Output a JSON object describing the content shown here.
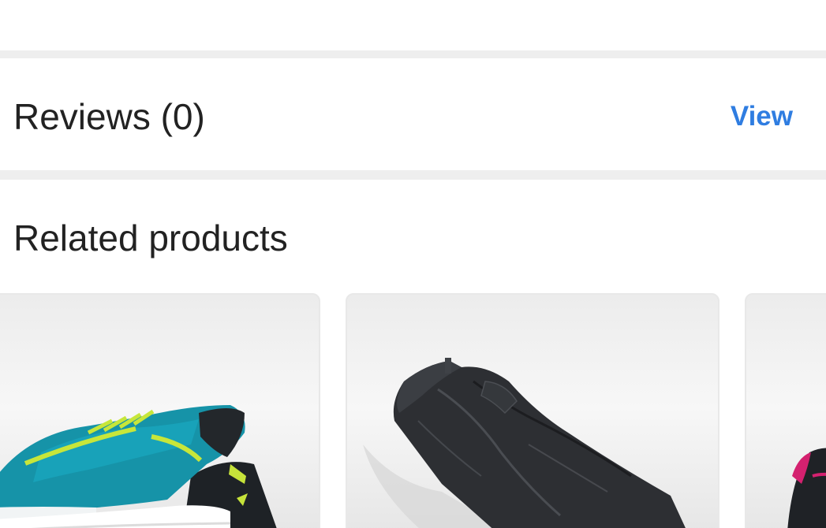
{
  "reviews": {
    "title": "Reviews (0)",
    "view_label": "View"
  },
  "related": {
    "title": "Related products",
    "products": [
      {
        "image": "teal-running-shoe-image"
      },
      {
        "image": "black-jeans-image"
      },
      {
        "image": "pink-black-shoe-image"
      }
    ]
  },
  "colors": {
    "link": "#2f7de1",
    "heading": "#222222",
    "divider": "#eeeeee"
  }
}
